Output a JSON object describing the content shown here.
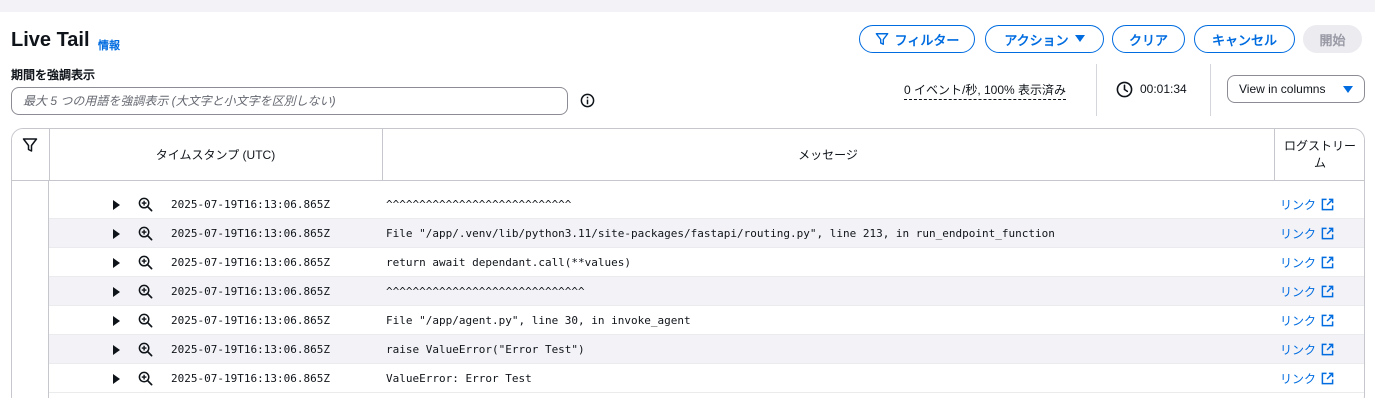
{
  "header": {
    "title": "Live Tail",
    "info_link": "情報"
  },
  "actions": {
    "filter": "フィルター",
    "action": "アクション",
    "clear": "クリア",
    "cancel": "キャンセル",
    "start": "開始"
  },
  "highlight": {
    "label": "期間を強調表示",
    "placeholder": "最大 5 つの用語を強調表示 (大文字と小文字を区別しない)"
  },
  "status": {
    "stats": "0 イベント/秒, 100% 表示済み",
    "timer": "00:01:34",
    "view_mode": "View in columns"
  },
  "table": {
    "columns": {
      "timestamp": "タイムスタンプ (UTC)",
      "message": "メッセージ",
      "log_stream": "ログストリーム"
    },
    "rows": [
      {
        "timestamp": "2025-07-19T16:13:06.865Z",
        "message": "^^^^^^^^^^^^^^^^^^^^^^^^^^^^",
        "link": "リンク"
      },
      {
        "timestamp": "2025-07-19T16:13:06.865Z",
        "message": "File \"/app/.venv/lib/python3.11/site-packages/fastapi/routing.py\", line 213, in run_endpoint_function",
        "link": "リンク"
      },
      {
        "timestamp": "2025-07-19T16:13:06.865Z",
        "message": "return await dependant.call(**values)",
        "link": "リンク"
      },
      {
        "timestamp": "2025-07-19T16:13:06.865Z",
        "message": "^^^^^^^^^^^^^^^^^^^^^^^^^^^^^^",
        "link": "リンク"
      },
      {
        "timestamp": "2025-07-19T16:13:06.865Z",
        "message": "File \"/app/agent.py\", line 30, in invoke_agent",
        "link": "リンク"
      },
      {
        "timestamp": "2025-07-19T16:13:06.865Z",
        "message": "raise ValueError(\"Error Test\")",
        "link": "リンク"
      },
      {
        "timestamp": "2025-07-19T16:13:06.865Z",
        "message": "ValueError: Error Test",
        "link": "リンク"
      }
    ]
  },
  "colors": {
    "accent": "#006ce0",
    "alt_row": "#f3f3f7",
    "border": "#c6c6cd"
  }
}
